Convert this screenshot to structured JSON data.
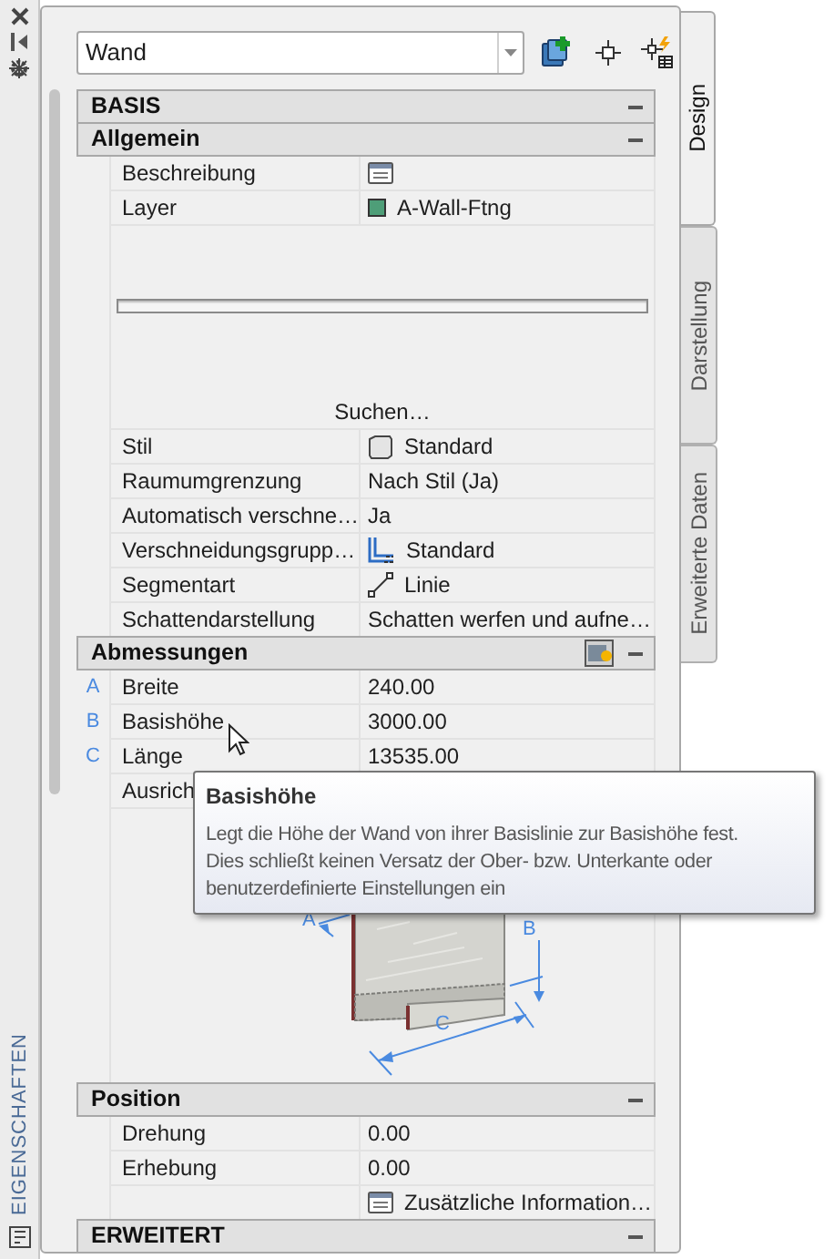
{
  "side_strip": {
    "label": "EIGENSCHAFTEN"
  },
  "object_selector": {
    "value": "Wand"
  },
  "tabs": [
    {
      "label": "Design",
      "selected": true
    },
    {
      "label": "Darstellung",
      "selected": false
    },
    {
      "label": "Erweiterte Daten",
      "selected": false
    }
  ],
  "sections": [
    {
      "title": "BASIS",
      "expanded": true
    },
    {
      "title": "Allgemein",
      "expanded": true,
      "rows": [
        {
          "kind": "description",
          "label": "Beschreibung"
        },
        {
          "kind": "layer",
          "label": "Layer",
          "value": "A-Wall-Ftng",
          "color": "#4e9e78"
        },
        {
          "kind": "search",
          "value": "Suchen…"
        },
        {
          "kind": "style",
          "label": "Stil",
          "value": "Standard"
        },
        {
          "kind": "plain",
          "label": "Raumumgrenzung",
          "value": "Nach Stil (Ja)"
        },
        {
          "kind": "plain",
          "label": "Automatisch verschne…",
          "value": "Ja"
        },
        {
          "kind": "intersection",
          "label": "Verschneidungsgrupp…",
          "value": "Standard"
        },
        {
          "kind": "segment",
          "label": "Segmentart",
          "value": "Linie"
        },
        {
          "kind": "plain",
          "label": "Schattendarstellung",
          "value": "Schatten werfen und aufne…"
        }
      ]
    },
    {
      "title": "Abmessungen",
      "expanded": true,
      "has_image_button": true,
      "rows": [
        {
          "kind": "plain",
          "marker": "A",
          "label": "Breite",
          "value": "240.00"
        },
        {
          "kind": "plain",
          "marker": "B",
          "label": "Basishöhe",
          "value": "3000.00"
        },
        {
          "kind": "plain",
          "marker": "C",
          "label": "Länge",
          "value": "13535.00"
        },
        {
          "kind": "plain",
          "label": "Ausrich"
        },
        {
          "kind": "diagram",
          "dimension_labels": [
            "A",
            "B",
            "C"
          ]
        }
      ]
    },
    {
      "title": "Position",
      "expanded": true,
      "rows": [
        {
          "kind": "plain",
          "label": "Drehung",
          "value": "0.00"
        },
        {
          "kind": "plain",
          "label": "Erhebung",
          "value": "0.00"
        },
        {
          "kind": "info",
          "value": "Zusätzliche Information…"
        }
      ]
    },
    {
      "title": "ERWEITERT",
      "expanded": true
    }
  ],
  "tooltip": {
    "title": "Basishöhe",
    "text": "Legt die Höhe der Wand von ihrer Basislinie zur Basishöhe fest. Dies schließt keinen Versatz der Ober- bzw. Unterkante oder benutzerdefinierte Einstellungen ein"
  }
}
